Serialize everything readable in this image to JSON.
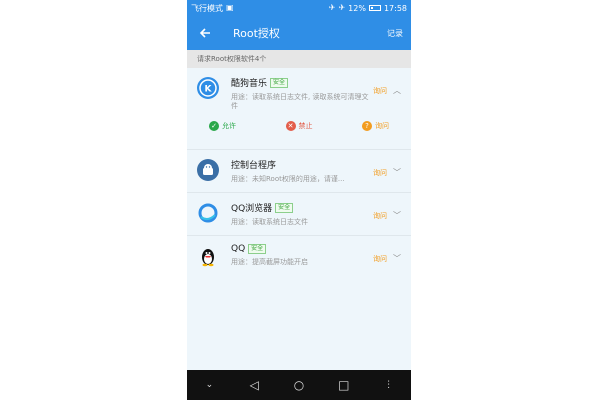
{
  "status_bar": {
    "left_text": "飞行模式",
    "battery": "12%",
    "time": "17:58"
  },
  "app_bar": {
    "title": "Root授权",
    "record_label": "记录"
  },
  "subheader": "请求Root权限软件4个",
  "apps": [
    {
      "name": "酷狗音乐",
      "badge": "安全",
      "usage": "用途：读取系统日志文件, 读取系统可清理文件",
      "ask": "询问",
      "icon": "kugou-icon"
    },
    {
      "name": "控制台程序",
      "badge": "",
      "usage": "用途：未知Root权限的用途，请谨...",
      "ask": "询问",
      "icon": "android-icon"
    },
    {
      "name": "QQ浏览器",
      "badge": "安全",
      "usage": "用途：读取系统日志文件",
      "ask": "询问",
      "icon": "qqbrowser-icon"
    },
    {
      "name": "QQ",
      "badge": "安全",
      "usage": "用途：提高截屏功能开启",
      "ask": "询问",
      "icon": "qq-penguin-icon"
    }
  ],
  "actions": {
    "allow": "允许",
    "deny": "禁止",
    "ask": "询问"
  },
  "colors": {
    "primary": "#2f8ee6",
    "ask": "#f29c1f",
    "allow": "#2aa84a",
    "deny": "#e35d4a"
  }
}
